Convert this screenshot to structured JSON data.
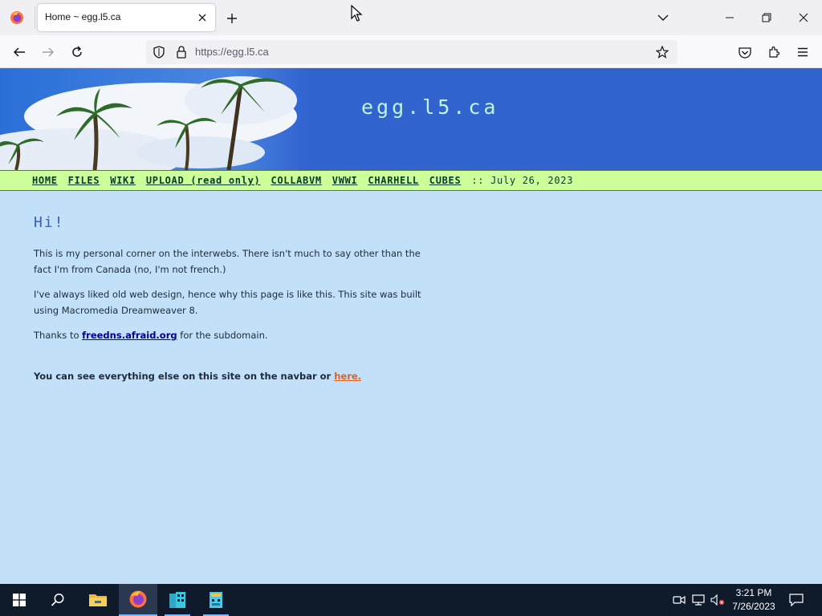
{
  "browser": {
    "tab": {
      "title": "Home ~ egg.l5.ca"
    },
    "url": "https://egg.l5.ca"
  },
  "page": {
    "site_title": "egg.l5.ca",
    "nav": {
      "links": [
        "HOME",
        "FILES",
        "WIKI",
        "UPLOAD (read only)",
        "COLLABVM",
        "VWWI",
        "CHARHELL",
        "CUBES"
      ],
      "date": ":: July 26, 2023"
    },
    "heading": "Hi!",
    "para1": "This is my personal corner on the interwebs. There isn't much to say other than the fact I'm from Canada (no, I'm not french.)",
    "para2": "I've always liked old web design, hence why this page is like this. This site was built using Macromedia Dreamweaver 8.",
    "para3": {
      "before": "Thanks to ",
      "link": "freedns.afraid.org",
      "after": " for the subdomain."
    },
    "closing": {
      "text": "You can see everything else on this site on the navbar or ",
      "link": "here."
    }
  },
  "taskbar": {
    "time": "3:21 PM",
    "date": "7/26/2023"
  },
  "colors": {
    "banner_bg": "#3264d0",
    "navbar_bg": "#ccff99",
    "page_bg": "#c2e0f8",
    "heading": "#3a5fb5",
    "here_link": "#e06020"
  },
  "icons": [
    "firefox-icon",
    "close-icon",
    "plus-icon",
    "chevron-down-icon",
    "minimize-icon",
    "restore-icon",
    "back-arrow-icon",
    "forward-arrow-icon",
    "reload-icon",
    "shield-icon",
    "lock-icon",
    "star-icon",
    "pocket-icon",
    "extensions-icon",
    "menu-icon",
    "windows-logo-icon",
    "search-icon",
    "file-explorer-icon",
    "app-icon",
    "meet-now-icon",
    "network-icon",
    "volume-muted-icon",
    "notification-icon"
  ]
}
